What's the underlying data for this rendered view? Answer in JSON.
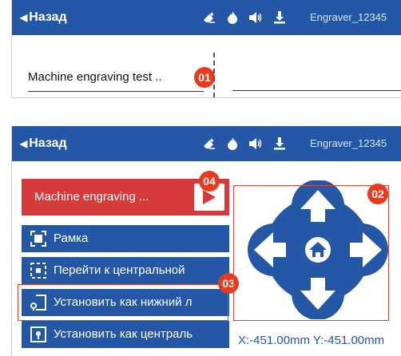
{
  "top_panel": {
    "back_label": "Назад",
    "device_name": "Engraver_12345",
    "file_name": "Machine engraving test ..",
    "badge": "01"
  },
  "bottom_panel": {
    "back_label": "Назад",
    "device_name": "Engraver_12345",
    "job_button_label": "Machine engraving ...",
    "menu_items": [
      {
        "label": "Рамка",
        "icon": "frame-icon"
      },
      {
        "label": "Перейти к центральной",
        "icon": "go-to-center-icon"
      },
      {
        "label": "Установить как нижний л",
        "icon": "set-bottom-left-icon"
      },
      {
        "label": "Установить как централь",
        "icon": "set-center-icon"
      }
    ],
    "coordinates": "X:-451.00mm Y:-451.00mm",
    "badges": {
      "dpad": "02",
      "menu": "03",
      "start": "04"
    }
  },
  "status_icons": [
    "eraser-icon",
    "flame-icon",
    "speaker-icon",
    "download-icon"
  ],
  "colors": {
    "header_blue": "#2457a6",
    "start_red": "#d63a3a",
    "badge_red": "#e63b1f"
  }
}
